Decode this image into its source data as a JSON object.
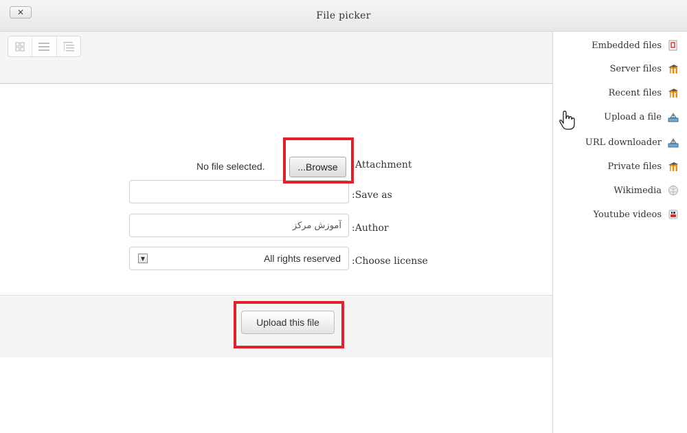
{
  "dialog": {
    "title": "File picker",
    "close_label": "✕"
  },
  "view_toggles": [
    {
      "name": "icons-view",
      "icon": "grid-icon"
    },
    {
      "name": "list-view",
      "icon": "list-icon"
    },
    {
      "name": "tree-view",
      "icon": "tree-icon"
    }
  ],
  "form": {
    "attachment_label": "Attachment",
    "no_file_text": "No file selected.",
    "browse_label": "...Browse",
    "saveas_label": ":Save as",
    "saveas_value": "",
    "author_label": ":Author",
    "author_value": "آموزش مرکز",
    "license_label": ":Choose license",
    "license_value": "All rights reserved",
    "upload_label": "Upload this file"
  },
  "repositories": [
    {
      "label": "Embedded files",
      "icon": "embedded-files-icon"
    },
    {
      "label": "Server files",
      "icon": "moodle-icon"
    },
    {
      "label": "Recent files",
      "icon": "moodle-icon"
    },
    {
      "label": "Upload a file",
      "icon": "upload-icon",
      "active": true
    },
    {
      "label": "URL downloader",
      "icon": "upload-icon"
    },
    {
      "label": "Private files",
      "icon": "moodle-icon"
    },
    {
      "label": "Wikimedia",
      "icon": "wikimedia-icon"
    },
    {
      "label": "Youtube videos",
      "icon": "youtube-icon"
    }
  ],
  "colors": {
    "highlight": "#e0202a",
    "moodle_orange": "#f08c00",
    "panel_bg": "#f5f5f5"
  }
}
